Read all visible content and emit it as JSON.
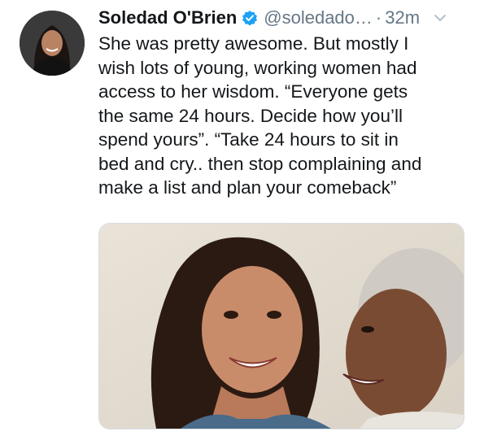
{
  "tweet": {
    "author": {
      "name": "Soledad O'Brien",
      "handle": "@soledado…",
      "separator": "·",
      "time": "32m",
      "verified_icon": "verified-badge-icon",
      "avatar": "author-avatar-photo"
    },
    "text_lines": [
      "She was pretty awesome. But mostly I",
      "wish lots of young, working women had",
      "access to her wisdom. “Everyone gets",
      "the same 24 hours. Decide how you’ll",
      "spend yours”. “Take 24 hours to sit in",
      "bed and cry.. then stop complaining and",
      "make a list and plan your comeback”"
    ],
    "menu_icon": "chevron-down-icon",
    "media": {
      "kind": "photo",
      "subject": "two smiling women portrait"
    }
  },
  "colors": {
    "primary_text": "#14171a",
    "secondary_text": "#657786",
    "verified_blue": "#1da1f2",
    "background": "#ffffff"
  }
}
